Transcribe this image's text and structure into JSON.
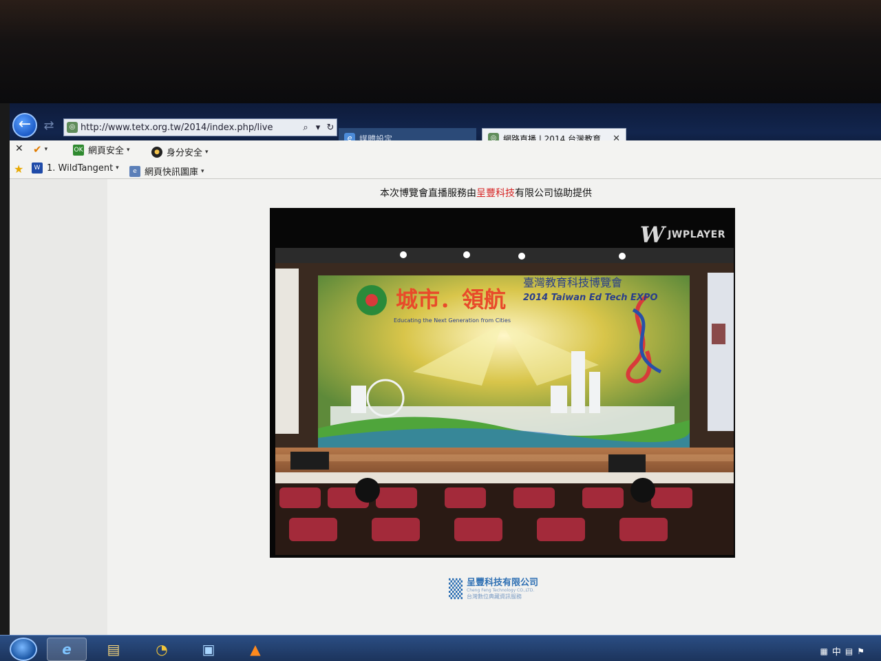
{
  "browser": {
    "address_url": "http://www.tetx.org.tw/2014/index.php/live",
    "tabs": [
      {
        "label": "媒體設定",
        "active": false
      },
      {
        "label": "網路直播 | 2014 台灣教育...",
        "active": true
      }
    ],
    "command_bar": {
      "web_safety_label": "網頁安全",
      "identity_safety_label": "身分安全",
      "favorite_item_label": "1. WildTangent",
      "web_slice_label": "網頁快訊圖庫"
    }
  },
  "page": {
    "notice_before": "本次博覽會直播服務由",
    "notice_highlight": "呈豐科技",
    "notice_after": "有限公司協助提供",
    "player": {
      "brand_label": "JWPLAYER"
    },
    "video_scene": {
      "banner_title": "城市．領航",
      "banner_subtitle": "臺灣教育科技博覽會",
      "banner_en": "2014 Taiwan Ed Tech EXPO",
      "banner_tagline": "Educating the Next Generation from Cities"
    },
    "footer": {
      "company_name": "呈豐科技有限公司",
      "company_en": "Cheng Feng Technology CO.,LTD.",
      "company_sub": "台灣數位典藏資訊服務"
    }
  },
  "taskbar": {
    "tray_text": "中"
  },
  "colors": {
    "accent_red": "#d62222",
    "brand_blue": "#2d6fb3"
  }
}
